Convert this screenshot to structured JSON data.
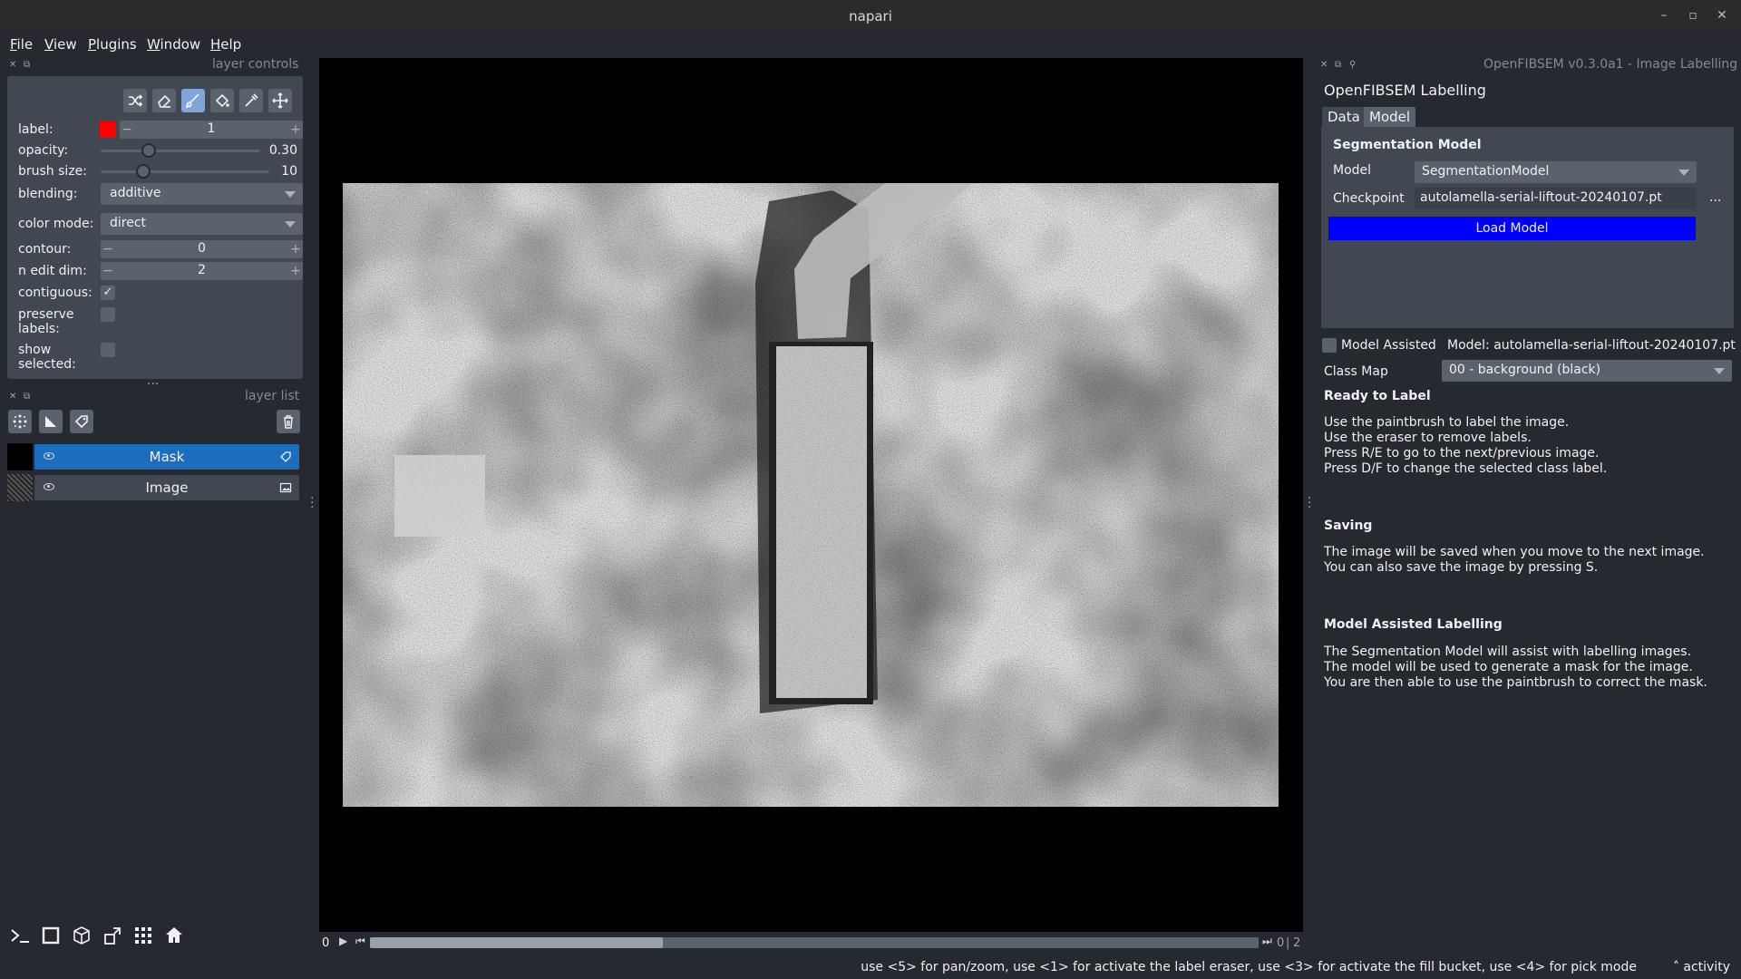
{
  "window": {
    "title": "napari"
  },
  "menu": [
    "File",
    "View",
    "Plugins",
    "Window",
    "Help"
  ],
  "layer_controls": {
    "dock_title": "layer controls",
    "tools": [
      "shuffle-icon",
      "eraser-icon",
      "paintbrush-icon",
      "fill-bucket-icon",
      "color-picker-icon",
      "pan-zoom-icon"
    ],
    "active_tool": "paintbrush-icon",
    "label": {
      "caption": "label:",
      "value": "1",
      "color": "#ff0000"
    },
    "opacity": {
      "caption": "opacity:",
      "value": "0.30",
      "fraction": 0.3
    },
    "brush_size": {
      "caption": "brush size:",
      "value": "10",
      "fraction": 0.25
    },
    "blending": {
      "caption": "blending:",
      "value": "additive"
    },
    "color_mode": {
      "caption": "color mode:",
      "value": "direct"
    },
    "contour": {
      "caption": "contour:",
      "value": "0"
    },
    "n_edit_dim": {
      "caption": "n edit dim:",
      "value": "2"
    },
    "contiguous": {
      "caption": "contiguous:",
      "checked": true
    },
    "preserve_labels": {
      "caption": "preserve\nlabels:",
      "checked": false
    },
    "show_selected": {
      "caption": "show\nselected:",
      "checked": false
    }
  },
  "layer_list": {
    "dock_title": "layer list",
    "layers": [
      {
        "name": "Mask",
        "selected": true
      },
      {
        "name": "Image",
        "selected": false
      }
    ]
  },
  "viewer": {
    "slider": {
      "current": "0",
      "max": "2",
      "position_fraction": 0.33
    },
    "status": "use <5> for pan/zoom, use <1> for activate the label eraser, use <3> for activate the fill bucket, use <4> for pick mode",
    "activity": "activity"
  },
  "plugin": {
    "dock_title": "OpenFIBSEM v0.3.0a1 - Image Labelling",
    "heading": "OpenFIBSEM Labelling",
    "tabs": [
      "Data",
      "Model"
    ],
    "active_tab": "Model",
    "model_group": {
      "title": "Segmentation Model",
      "model_label": "Model",
      "model_value": "SegmentationModel",
      "checkpoint_label": "Checkpoint",
      "checkpoint_value": "autolamella-serial-liftout-20240107.pt",
      "browse": "...",
      "load_button": "Load Model",
      "load_color": "#0000ff"
    },
    "model_assisted": {
      "label": "Model Assisted",
      "checked": false,
      "model_text": "Model: autolamella-serial-liftout-20240107.pt"
    },
    "class_map": {
      "label": "Class Map",
      "value": "00 - background (black)"
    },
    "ready": {
      "title": "Ready to Label",
      "lines": [
        "Use the paintbrush to label the image.",
        "Use the eraser to remove labels.",
        "Press R/E to go to the next/previous image.",
        "Press D/F to change the selected class label."
      ]
    },
    "saving": {
      "title": "Saving",
      "lines": [
        "The image will be saved when you move to the next image.",
        "You can also save the image by pressing S."
      ]
    },
    "assisted": {
      "title": "Model Assisted Labelling",
      "lines": [
        "The Segmentation Model will assist with labelling images.",
        "The model will be used to generate a mask for the image.",
        "You are then able to use the paintbrush to correct the mask."
      ]
    }
  },
  "colors": {
    "background": "#262930",
    "panel": "#414851",
    "selected_layer": "#1d6dbf",
    "highlight": "#7ea6d9"
  }
}
